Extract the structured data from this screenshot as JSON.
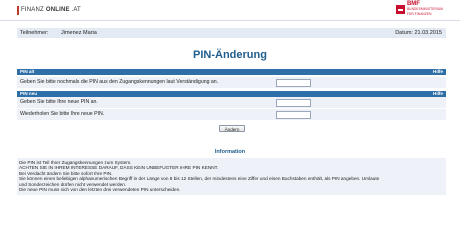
{
  "header": {
    "logo_part1": "FINANZ",
    "logo_part2": "ONLINE",
    "logo_part3": ".AT",
    "bmf_title": "BMF",
    "bmf_sub1": "BUNDESMINISTERIUM",
    "bmf_sub2": "FÜR FINANZEN"
  },
  "user": {
    "label": "Teilnehmer:",
    "name": "Jimenez Maria",
    "date": "Datum: 21.03.2015"
  },
  "page_title": "PIN-Änderung",
  "section_old": {
    "title": "PIN alt",
    "help": "Hilfe",
    "question": "Geben Sie bitte nochmals die PIN aus den Zugangskennungen laut Verständigung an."
  },
  "section_new": {
    "title": "PIN neu",
    "help": "Hilfe",
    "question1": "Geben Sie bitte Ihre neue PIN an.",
    "question2": "Wiederholen Sie bitte Ihre neue PIN."
  },
  "submit_label": "Ändern",
  "info": {
    "title": "Information",
    "lines": [
      "Die PIN ist Teil Ihrer Zugangskennungen zum System.",
      "ACHTEN SIE IN IHREM INTERESSE DARAUF, DASS KEIN UNBEFUGTER IHRE PIN KENNT.",
      "Bei Verdacht ändern Sie bitte sofort Ihre PIN.",
      "Sie können einen beliebigen alphanumerischen Begriff in der Länge von 8 bis 12 Stellen, der mindestens eine Ziffer und einen Buchstaben enthält, als PIN angeben. Umlaute",
      "und Sonderzeichen dürfen nicht verwendet werden.",
      "Die neue PIN muss sich von den letzten drei verwendeten PIN unterscheiden."
    ]
  },
  "colors": {
    "accent": "#2e6fa8",
    "title": "#1f5d8c",
    "brand_red": "#c8102e"
  }
}
